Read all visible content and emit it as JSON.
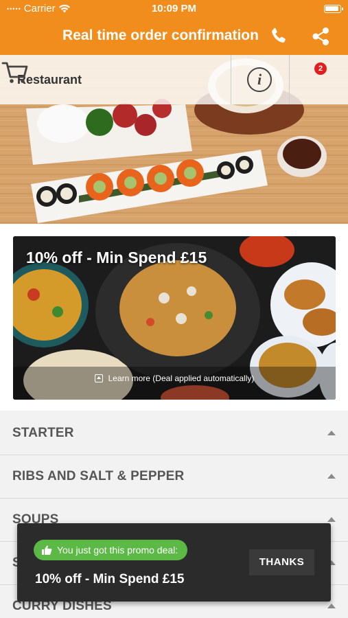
{
  "status_bar": {
    "carrier": "Carrier",
    "time": "10:09 PM"
  },
  "nav": {
    "title": "Real time order confirmation"
  },
  "header": {
    "restaurant_label": "Restaurant",
    "info_glyph": "i",
    "cart_count": "2"
  },
  "promo": {
    "title": "10% off - Min Spend £15",
    "learn_more": "Learn more (Deal applied automatically)"
  },
  "categories": [
    {
      "label": "STARTER"
    },
    {
      "label": "RIBS AND SALT & PEPPER"
    },
    {
      "label": "SOUPS"
    },
    {
      "label": "S"
    },
    {
      "label": "CURRY DISHES"
    }
  ],
  "toast": {
    "pill_text": "You just got this promo deal:",
    "message": "10% off - Min Spend £15",
    "button": "THANKS"
  },
  "colors": {
    "brand": "#f08d1c",
    "toast_bg": "#2b2b2b",
    "pill_green": "#5cb946",
    "badge_red": "#e02020"
  },
  "icons": [
    "wifi-icon",
    "battery-icon",
    "phone-icon",
    "share-icon",
    "info-icon",
    "cart-icon",
    "thumbs-up-icon",
    "learn-more-icon",
    "chevron-up-icon"
  ]
}
